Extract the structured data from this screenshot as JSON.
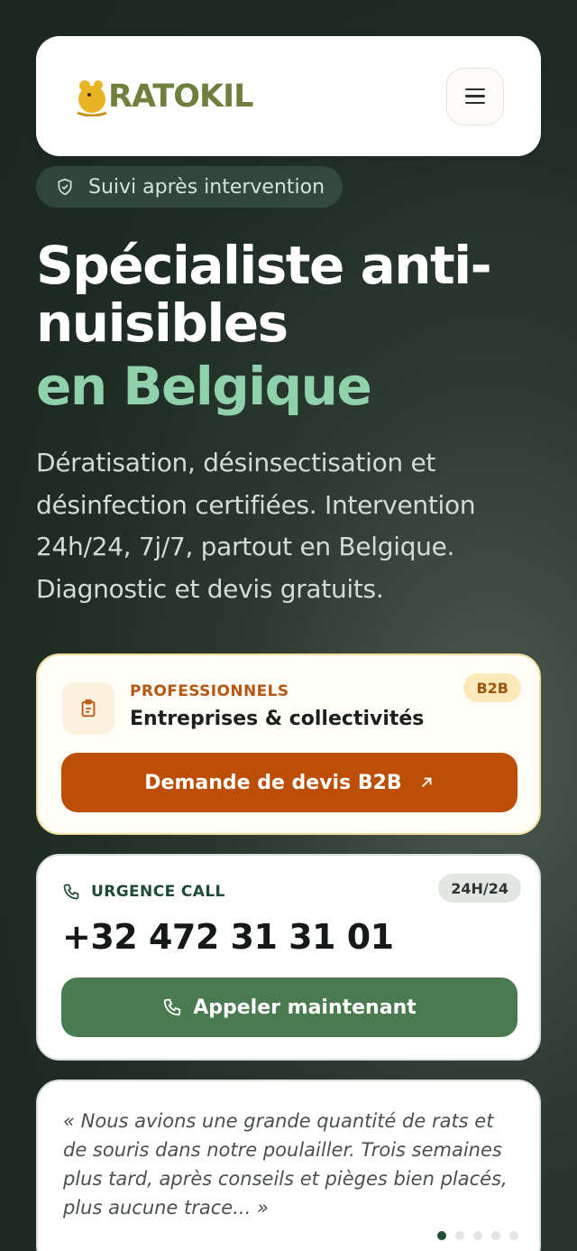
{
  "header": {
    "logo_text": "RATOKIL",
    "logo_icon": "rat-mascot-icon",
    "menu_icon": "hamburger-menu-icon"
  },
  "badge": {
    "icon": "shield-check-icon",
    "text": "Suivi après intervention"
  },
  "hero": {
    "title_line1": "Spécialiste anti-",
    "title_line2": "nuisibles",
    "title_accent": "en Belgique",
    "subtitle": "Dératisation, désinsectisation et désinfection certifiées. Intervention 24h/24, 7j/7, partout en Belgique. Diagnostic et devis gratuits."
  },
  "b2b_card": {
    "icon": "clipboard-icon",
    "label": "PROFESSIONNELS",
    "title": "Entreprises & collectivités",
    "pill": "B2B",
    "button_label": "Demande de devis B2B",
    "button_icon": "arrow-up-right-icon"
  },
  "call_card": {
    "icon": "phone-icon",
    "label": "URGENCE CALL",
    "pill": "24H/24",
    "phone": "+32 472 31 31 01",
    "button_label": "Appeler maintenant",
    "button_icon": "phone-icon"
  },
  "testimonial": {
    "quote": "« Nous avions une grande quantité de rats et de souris dans notre poulailler. Trois semaines plus tard, après conseils et pièges bien placés, plus aucune trace... »",
    "dots_total": 5,
    "active_dot": 1
  },
  "colors": {
    "accent_green": "#8fd1ab",
    "orange_button": "#bc4f05",
    "green_button": "#4a7a4f",
    "logo": "#6f7f3c"
  }
}
